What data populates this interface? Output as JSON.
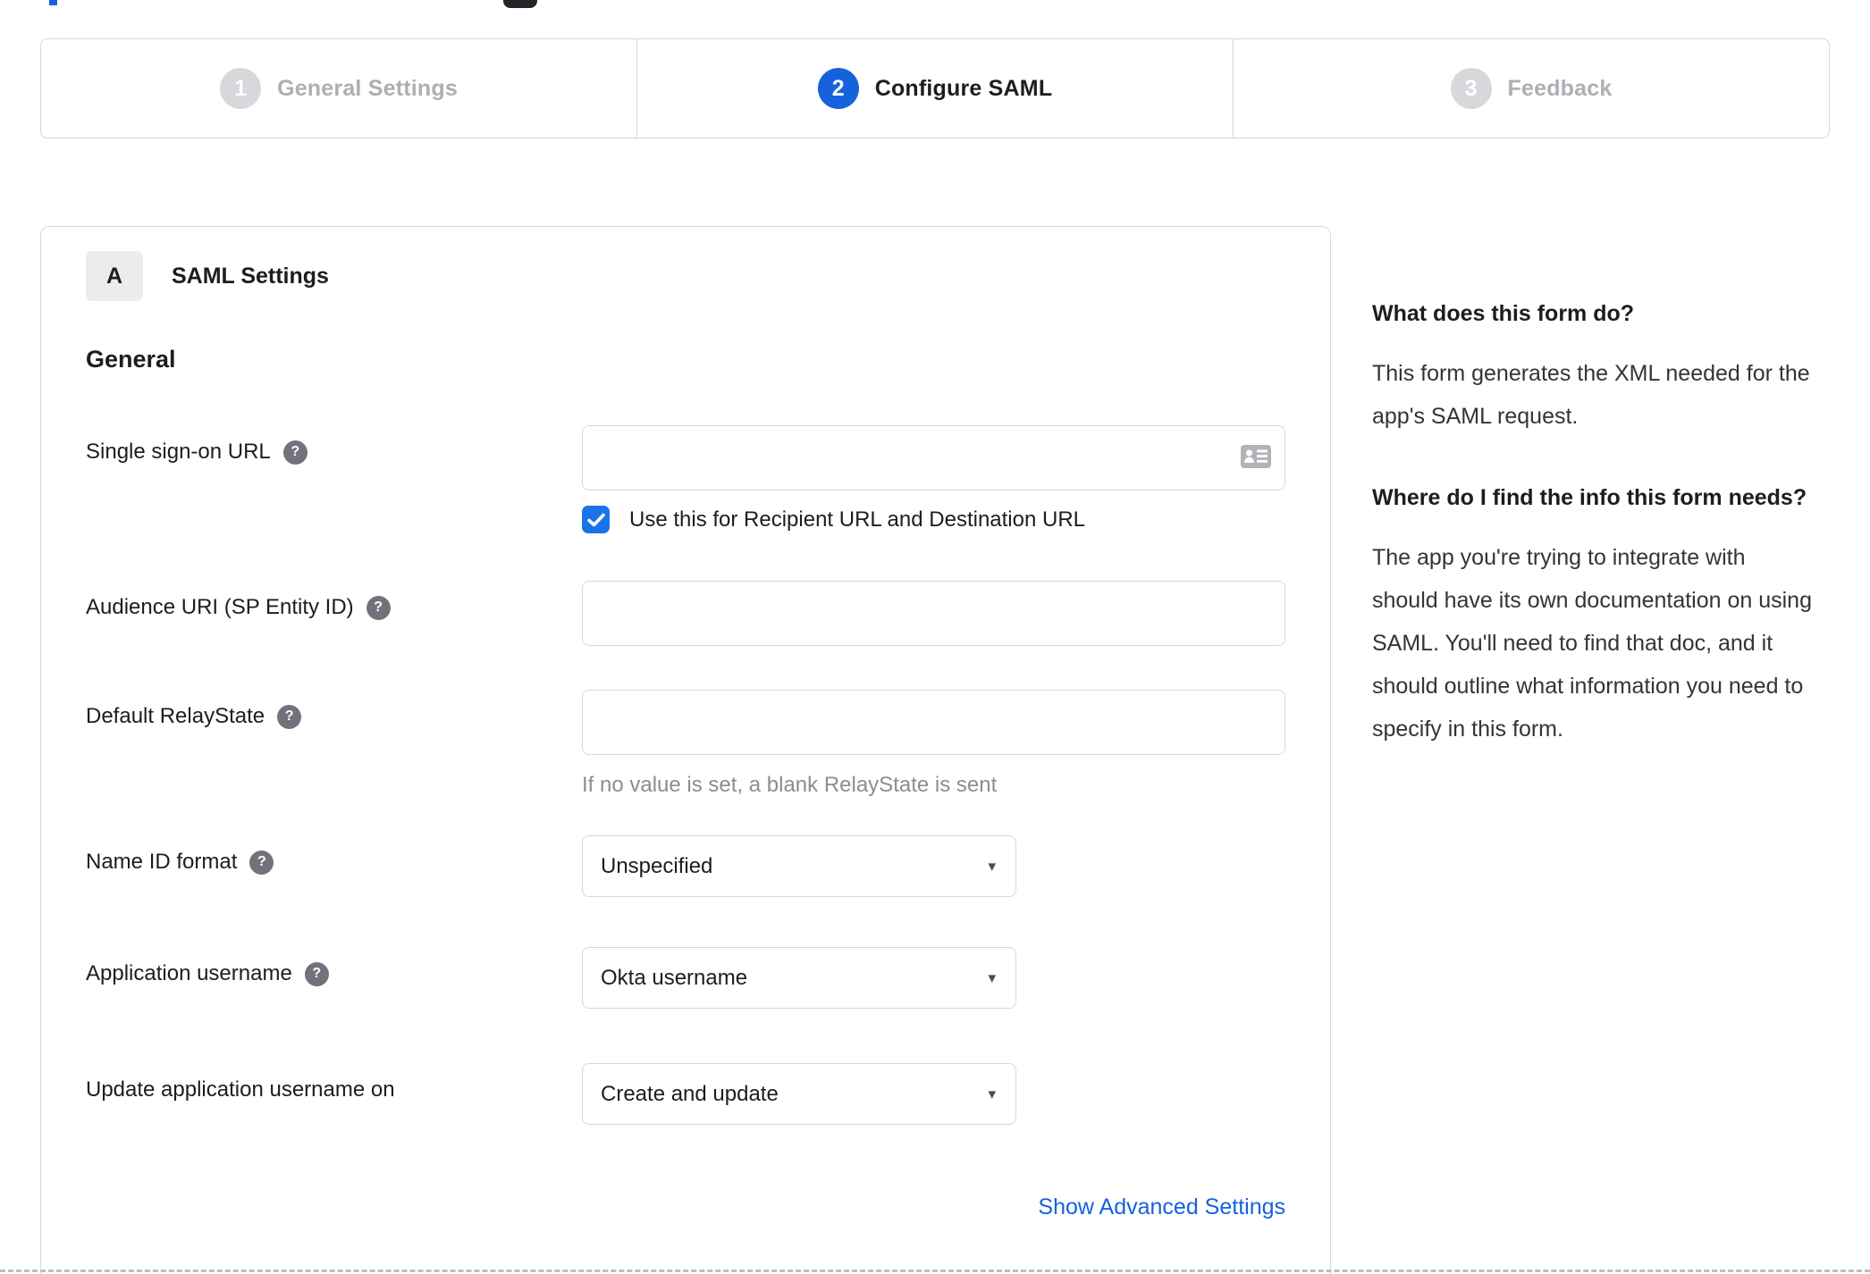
{
  "colors": {
    "accent_blue": "#1662dd",
    "checkbox_blue": "#1a73e8",
    "inactive_gray": "#d8d8dc",
    "border_gray": "#d7d7dc",
    "text_dark": "#1d1d21",
    "hint_gray": "#8c8c96"
  },
  "icons": {
    "help_glyph": "?",
    "caret_glyph": "▾"
  },
  "stepper": {
    "steps": [
      {
        "number": "1",
        "label": "General Settings",
        "state": "inactive"
      },
      {
        "number": "2",
        "label": "Configure SAML",
        "state": "active"
      },
      {
        "number": "3",
        "label": "Feedback",
        "state": "inactive"
      }
    ]
  },
  "panel": {
    "section_badge": "A",
    "section_title": "SAML Settings",
    "group_heading": "General"
  },
  "form": {
    "fields": [
      {
        "label": "Single sign-on URL",
        "type": "text",
        "value": "",
        "checkbox": {
          "checked": true,
          "label": "Use this for Recipient URL and Destination URL"
        }
      },
      {
        "label": "Audience URI (SP Entity ID)",
        "type": "text",
        "value": ""
      },
      {
        "label": "Default RelayState",
        "type": "text",
        "value": "",
        "hint": "If no value is set, a blank RelayState is sent"
      },
      {
        "label": "Name ID format",
        "type": "select",
        "value": "Unspecified"
      },
      {
        "label": "Application username",
        "type": "select",
        "value": "Okta username"
      },
      {
        "label": "Update application username on",
        "type": "select",
        "value": "Create and update"
      }
    ],
    "advanced_link": "Show Advanced Settings"
  },
  "sidebar": {
    "sections": [
      {
        "heading": "What does this form do?",
        "body": "This form generates the XML needed for the app's SAML request."
      },
      {
        "heading": "Where do I find the info this form needs?",
        "body": "The app you're trying to integrate with should have its own documentation on using SAML. You'll need to find that doc, and it should outline what information you need to specify in this form."
      }
    ]
  }
}
